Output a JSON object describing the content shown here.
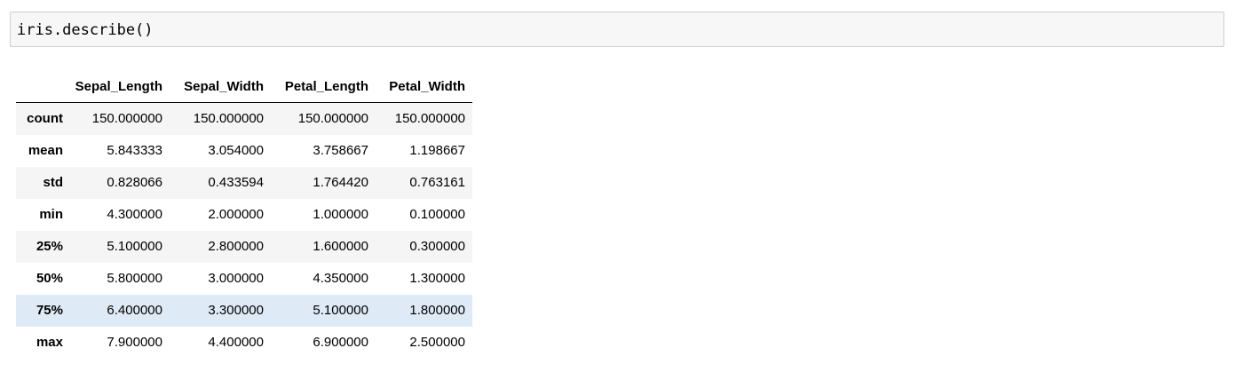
{
  "code_cell": {
    "source": "iris.describe()"
  },
  "table": {
    "columns": [
      "Sepal_Length",
      "Sepal_Width",
      "Petal_Length",
      "Petal_Width"
    ],
    "rows": [
      {
        "index": "count",
        "values": [
          "150.000000",
          "150.000000",
          "150.000000",
          "150.000000"
        ]
      },
      {
        "index": "mean",
        "values": [
          "5.843333",
          "3.054000",
          "3.758667",
          "1.198667"
        ]
      },
      {
        "index": "std",
        "values": [
          "0.828066",
          "0.433594",
          "1.764420",
          "0.763161"
        ]
      },
      {
        "index": "min",
        "values": [
          "4.300000",
          "2.000000",
          "1.000000",
          "0.100000"
        ]
      },
      {
        "index": "25%",
        "values": [
          "5.100000",
          "2.800000",
          "1.600000",
          "0.300000"
        ]
      },
      {
        "index": "50%",
        "values": [
          "5.800000",
          "3.000000",
          "4.350000",
          "1.300000"
        ]
      },
      {
        "index": "75%",
        "values": [
          "6.400000",
          "3.300000",
          "5.100000",
          "1.800000"
        ]
      },
      {
        "index": "max",
        "values": [
          "7.900000",
          "4.400000",
          "6.900000",
          "2.500000"
        ]
      }
    ],
    "highlighted_row": 6
  },
  "colors": {
    "stripe": "#f5f5f5",
    "hover": "#dfeaf7",
    "code_background": "#f7f7f7",
    "code_border": "#cfcfcf"
  }
}
